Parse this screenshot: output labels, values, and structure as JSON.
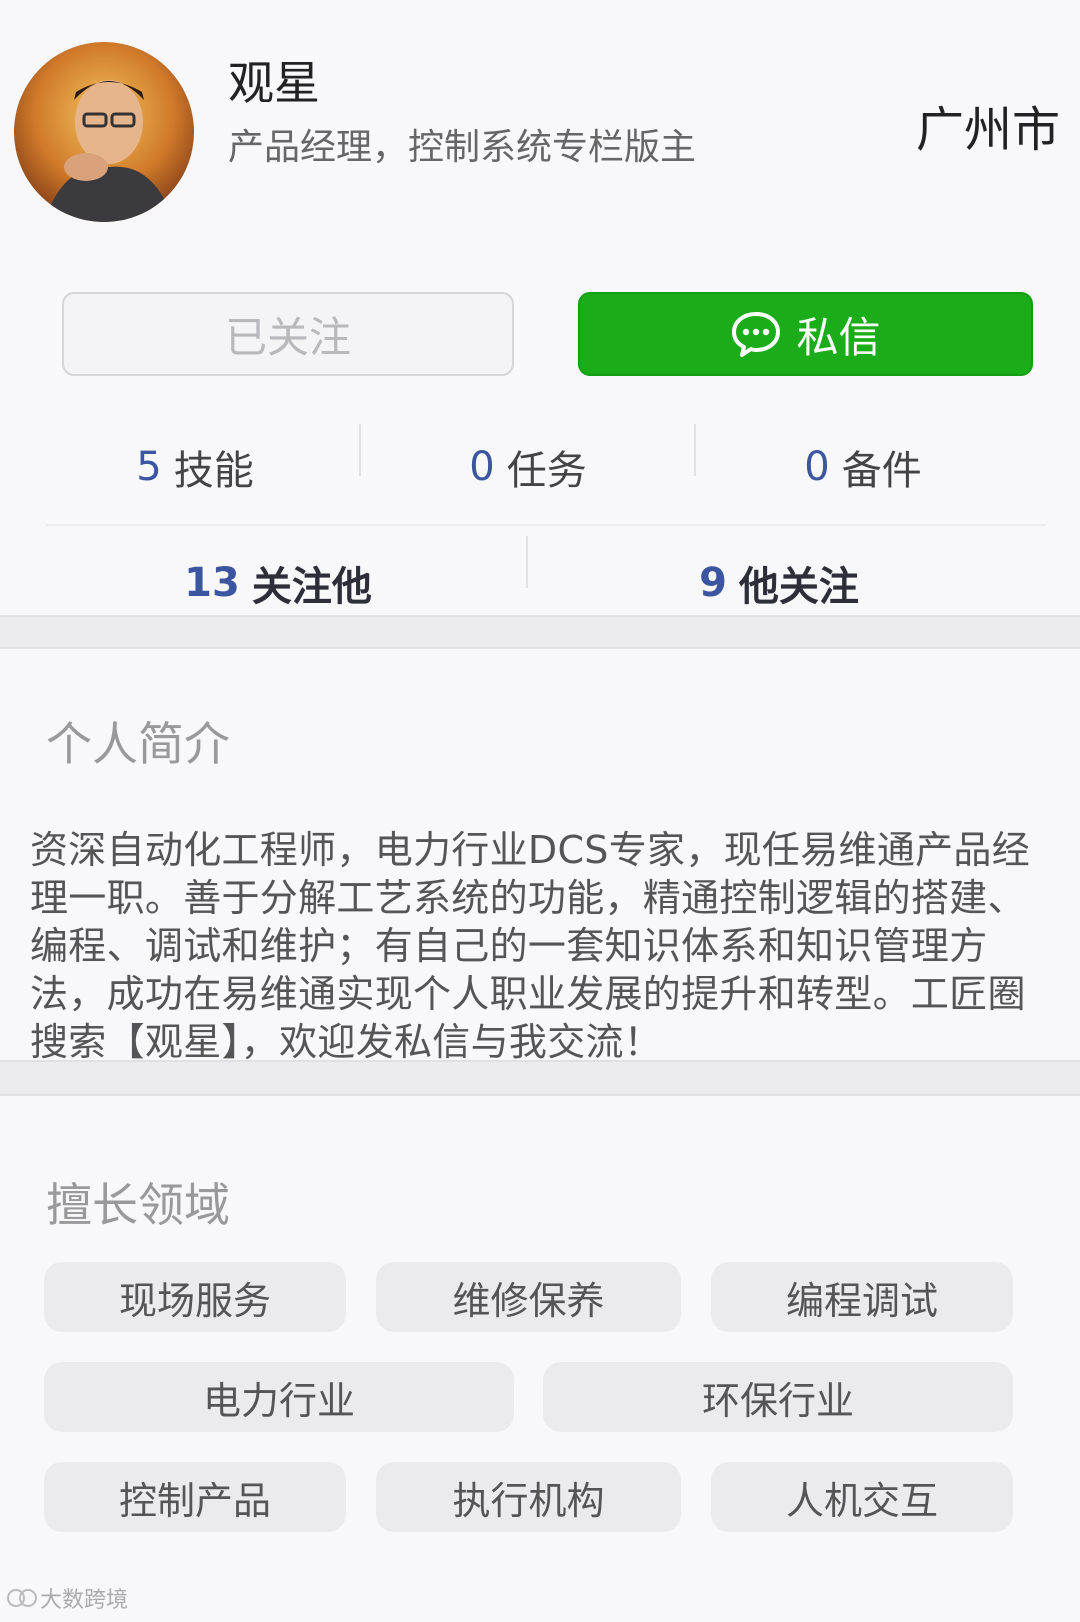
{
  "profile": {
    "name": "观星",
    "title": "产品经理，控制系统专栏版主",
    "city": "广州市"
  },
  "actions": {
    "follow_label": "已关注",
    "message_label": "私信"
  },
  "stats": {
    "skills": {
      "count": "5",
      "label": "技能"
    },
    "tasks": {
      "count": "0",
      "label": "任务"
    },
    "parts": {
      "count": "0",
      "label": "备件"
    },
    "followers": {
      "count": "13",
      "label": "关注他"
    },
    "following": {
      "count": "9",
      "label": "他关注"
    }
  },
  "bio": {
    "heading": "个人简介",
    "text": "资深自动化工程师，电力行业DCS专家，现任易维通产品经理一职。善于分解工艺系统的功能，精通控制逻辑的搭建、编程、调试和维护；有自己的一套知识体系和知识管理方法，成功在易维通实现个人职业发展的提升和转型。工匠圈搜索【观星】，欢迎发私信与我交流！"
  },
  "skills": {
    "heading": "擅长领域",
    "tags": [
      "现场服务",
      "维修保养",
      "编程调试",
      "电力行业",
      "环保行业",
      "控制产品",
      "执行机构",
      "人机交互"
    ]
  },
  "watermark": "大数跨境",
  "colors": {
    "accent_green": "#1aad19",
    "number_blue": "#3c55a0"
  }
}
